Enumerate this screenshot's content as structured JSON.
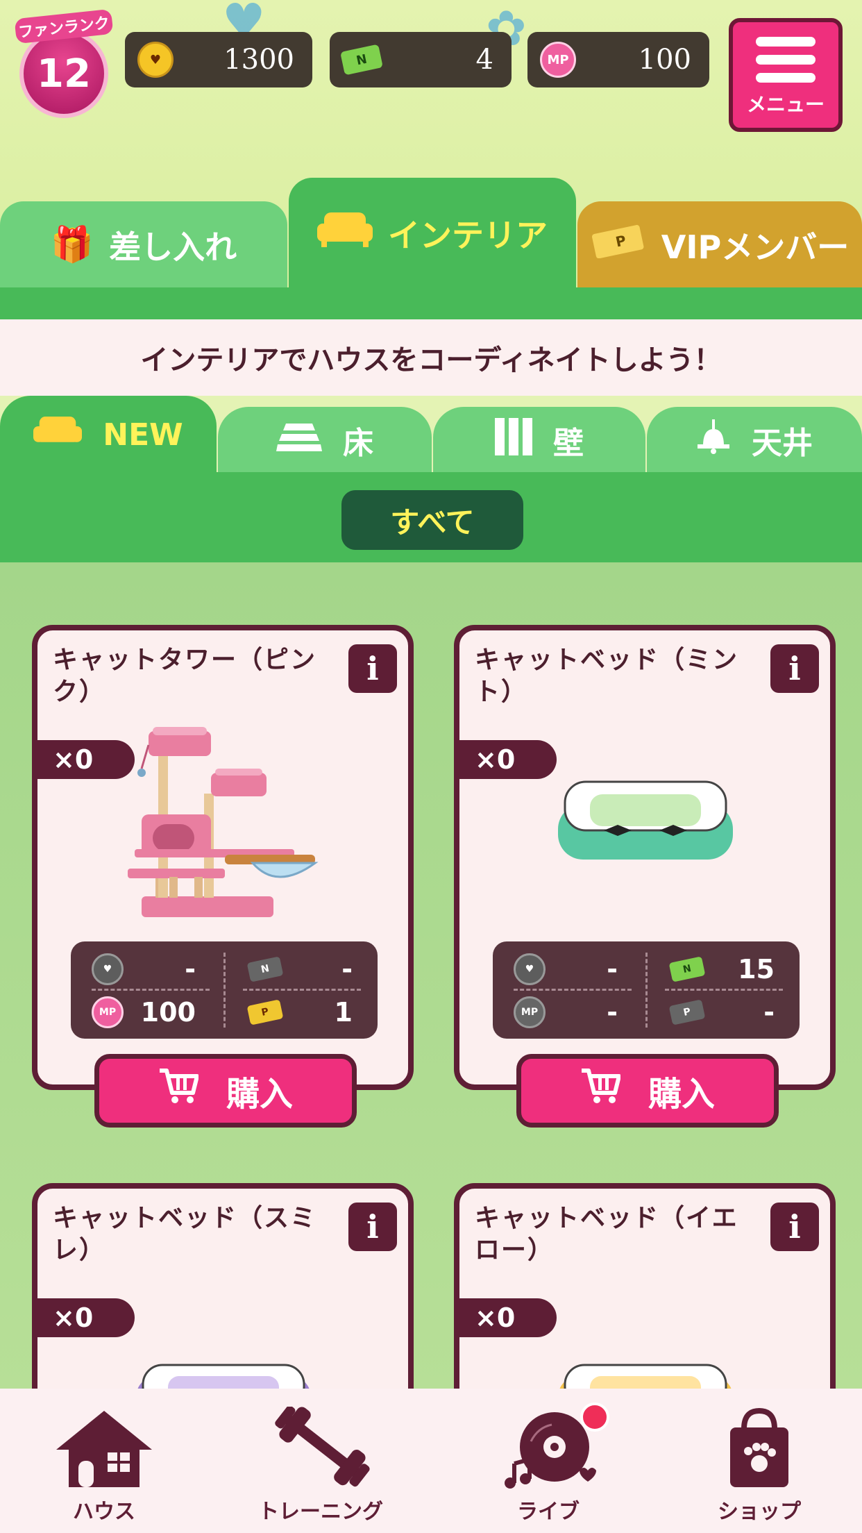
{
  "status": {
    "fan_rank_label": "ファンランク",
    "fan_rank": "12",
    "coins": "1300",
    "n_tickets": "4",
    "mp": "100"
  },
  "menu": {
    "label": "メニュー"
  },
  "main_tabs": [
    {
      "label": "差し入れ",
      "icon": "gift-icon"
    },
    {
      "label": "インテリア",
      "icon": "sofa-icon",
      "active": true
    },
    {
      "label": "VIPメンバー",
      "icon": "p-ticket-icon"
    }
  ],
  "subtitle": "インテリアでハウスをコーディネイトしよう！",
  "category_tabs": [
    {
      "label": "NEW",
      "icon": "sofa-icon",
      "active": true
    },
    {
      "label": "床",
      "icon": "floor-icon"
    },
    {
      "label": "壁",
      "icon": "wall-icon"
    },
    {
      "label": "天井",
      "icon": "ceiling-lamp-icon"
    }
  ],
  "filter": {
    "label": "すべて"
  },
  "items": [
    {
      "name": "キャットタワー（ピンク）",
      "qty": "×0",
      "price": {
        "coin": "-",
        "n_ticket": "-",
        "mp": "100",
        "p_ticket": "1"
      },
      "buy_label": "購入"
    },
    {
      "name": "キャットベッド（ミント）",
      "qty": "×0",
      "price": {
        "coin": "-",
        "n_ticket": "15",
        "mp": "-",
        "p_ticket": "-"
      },
      "buy_label": "購入"
    },
    {
      "name": "キャットベッド（スミレ）",
      "qty": "×0"
    },
    {
      "name": "キャットベッド（イエロー）",
      "qty": "×0"
    }
  ],
  "bottom_nav": [
    {
      "label": "ハウス",
      "icon": "house-icon"
    },
    {
      "label": "トレーニング",
      "icon": "dumbbell-icon"
    },
    {
      "label": "ライブ",
      "icon": "record-icon",
      "badge": true
    },
    {
      "label": "ショップ",
      "icon": "shopping-bag-icon"
    }
  ],
  "colors": {
    "accent_pink": "#ef2f7d",
    "tab_green": "#48ba58",
    "tab_light_green": "#6ed17c",
    "vip_gold": "#d2a22e",
    "dark_maroon": "#5e1e35"
  }
}
